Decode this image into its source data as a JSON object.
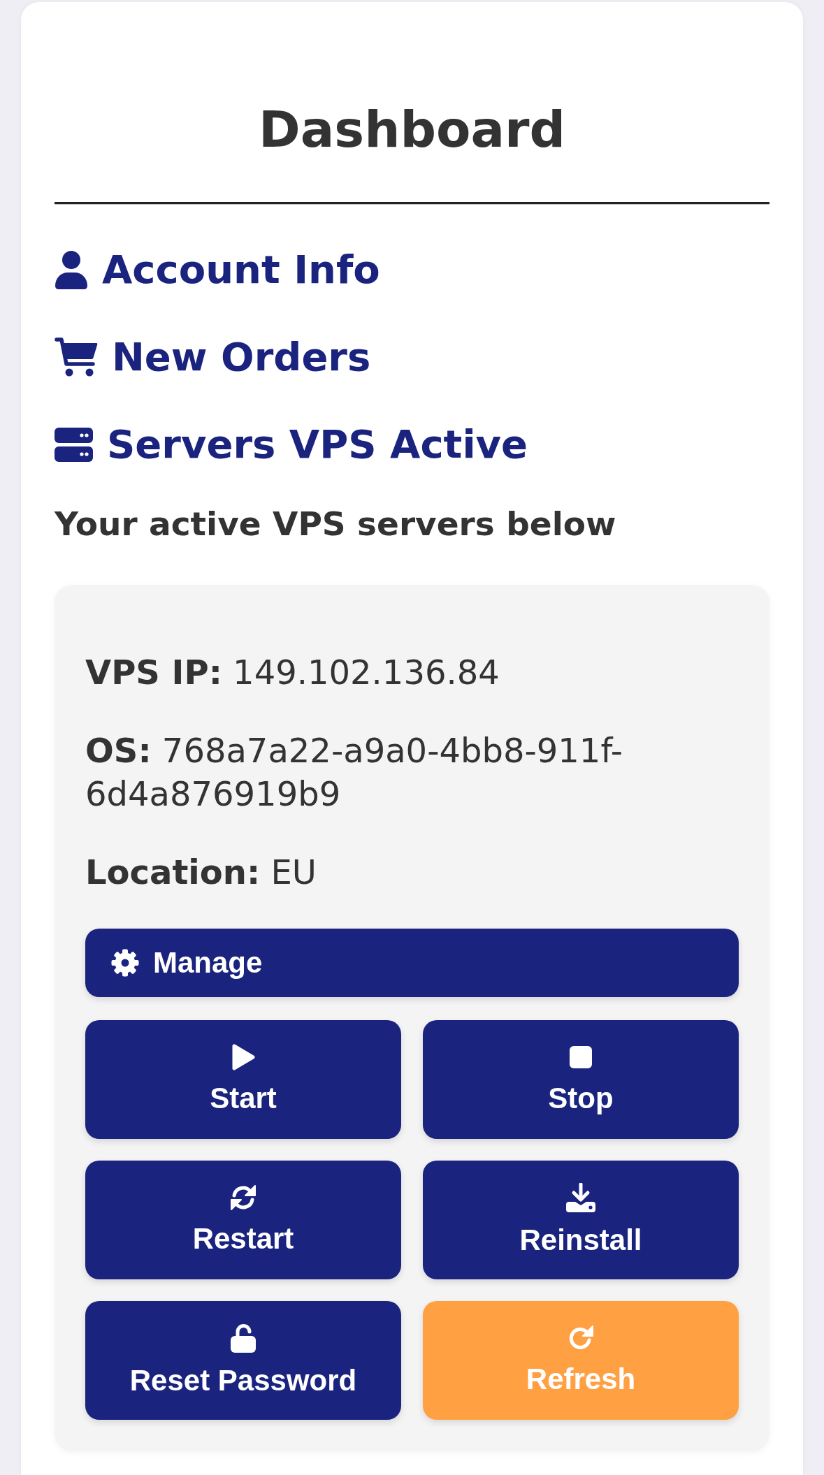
{
  "page": {
    "title": "Dashboard"
  },
  "nav_links": [
    {
      "label": "Account Info"
    },
    {
      "label": "New Orders"
    },
    {
      "label": "Servers VPS Active"
    }
  ],
  "section_note": "Your active VPS servers below",
  "server_card": {
    "fields": [
      {
        "label": "VPS IP:",
        "value": "149.102.136.84"
      },
      {
        "label": "OS:",
        "value": "768a7a22-a9a0-4bb8-911f-6d4a876919b9"
      },
      {
        "label": "Location:",
        "value": "EU"
      }
    ],
    "manage_button": {
      "label": "Manage"
    },
    "actions": [
      {
        "label": "Start",
        "color": "#1a237e"
      },
      {
        "label": "Stop",
        "color": "#1a237e"
      },
      {
        "label": "Restart",
        "color": "#1a237e"
      },
      {
        "label": "Reinstall",
        "color": "#1a237e"
      },
      {
        "label": "Reset Password",
        "color": "#1a237e"
      },
      {
        "label": "Refresh",
        "color": "#ffa043"
      }
    ]
  }
}
